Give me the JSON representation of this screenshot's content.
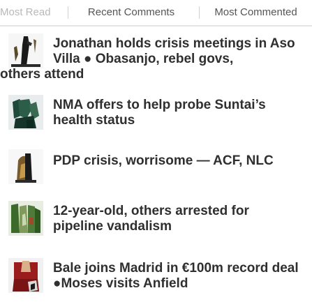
{
  "tabs": [
    {
      "label": "Most Read",
      "active": false
    },
    {
      "label": "Recent Comments",
      "active": true
    },
    {
      "label": "Most Commented",
      "active": false
    }
  ],
  "articles": [
    {
      "headline": "Jonathan holds crisis meetings in Aso Villa ● Obasanjo, rebel govs,",
      "headline_tail": "others attend",
      "thumb_icon": "photo-thumbnail-icon"
    },
    {
      "headline": "NMA offers to help probe Suntai’s health status",
      "thumb_icon": "photo-thumbnail-icon"
    },
    {
      "headline": "PDP crisis, worrisome — ACF, NLC",
      "thumb_icon": "photo-thumbnail-icon"
    },
    {
      "headline": "12-year-old, others arrested for pipeline vandalism",
      "thumb_icon": "photo-thumbnail-icon"
    },
    {
      "headline": "Bale joins Madrid in €100m record deal ●Moses visits Anfield",
      "thumb_icon": "photo-thumbnail-icon"
    }
  ]
}
